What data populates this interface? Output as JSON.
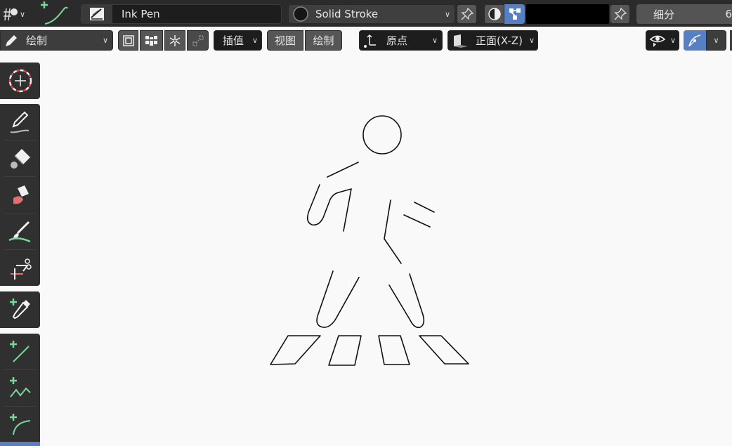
{
  "header": {
    "brush_name": "Ink Pen",
    "stroke_material": "Solid Stroke",
    "subdivide_label": "细分",
    "subdivide_value": "6",
    "color_swatch": "#000000"
  },
  "tool_settings": {
    "mode_label": "绘制",
    "interpolate_label": "插值",
    "view_button": "视图",
    "draw_button": "绘制",
    "origin_label": "原点",
    "plane_label": "正面(X-Z)"
  },
  "colors": {
    "accent": "#5680c2",
    "green": "#7bd69a",
    "toolbar_bg": "#303030",
    "header_bg": "#2b2b2b"
  },
  "toolbar": {
    "tools": [
      "cursor-tool",
      "draw-tool",
      "fill-tool",
      "erase-tool",
      "tint-tool",
      "cutter-tool",
      "eyedropper-tool",
      "line-tool",
      "polyline-tool",
      "arc-tool"
    ]
  }
}
